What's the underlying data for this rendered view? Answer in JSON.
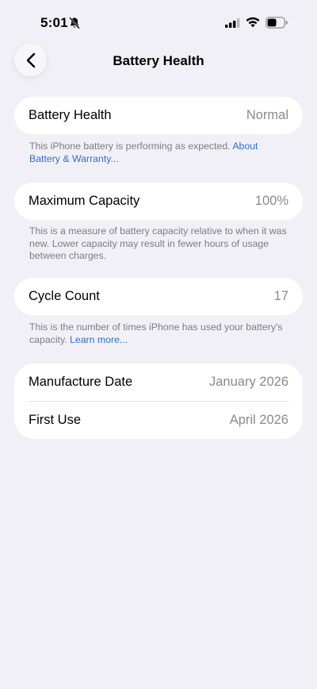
{
  "status_bar": {
    "time": "5:01",
    "icons": [
      "bell-slash-icon",
      "signal-icon",
      "wifi-icon",
      "battery-icon"
    ],
    "battery_level": 0.55
  },
  "nav": {
    "back_icon": "chevron-left-icon",
    "title": "Battery Health"
  },
  "battery_health": {
    "label": "Battery Health",
    "value": "Normal",
    "note": "This iPhone battery is performing as expected. ",
    "link": "About Battery & Warranty..."
  },
  "maximum_capacity": {
    "label": "Maximum Capacity",
    "value": "100%",
    "note": "This is a measure of battery capacity relative to when it was new. Lower capacity may result in fewer hours of usage between charges."
  },
  "cycle_count": {
    "label": "Cycle Count",
    "value": "17",
    "note": "This is the number of times iPhone has used your battery's capacity. ",
    "link": "Learn more..."
  },
  "dates": {
    "manufacture_label": "Manufacture Date",
    "manufacture_value": "January 2026",
    "first_use_label": "First Use",
    "first_use_value": "April 2026"
  },
  "colors": {
    "background": "#f1f0f6",
    "link": "#2f6fd0",
    "secondary_text": "#8a8a8e"
  }
}
